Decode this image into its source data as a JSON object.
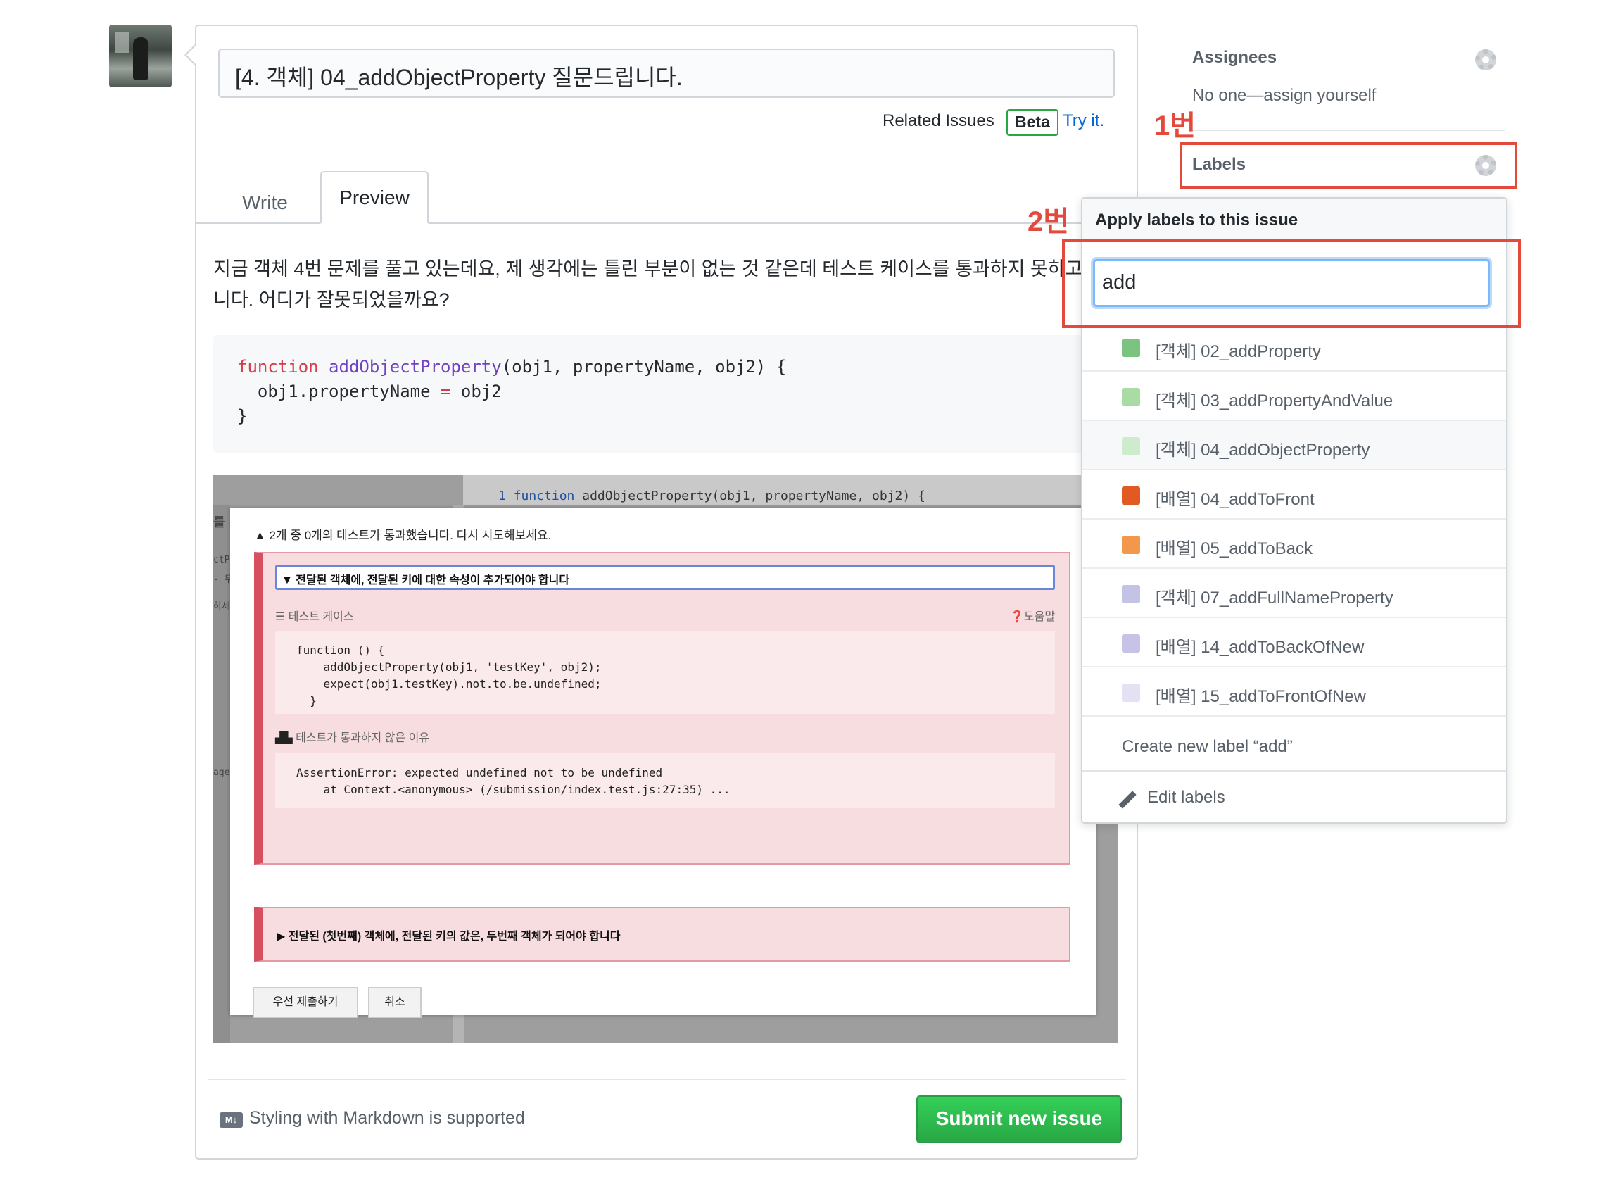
{
  "issue": {
    "title_value": "[4. 객체] 04_addObjectProperty 질문드립니다.",
    "related_label": "Related Issues",
    "beta_badge": "Beta",
    "try_link": "Try it."
  },
  "tabs": {
    "write": "Write",
    "preview": "Preview"
  },
  "preview": {
    "text_line1": "지금 객체 4번 문제를 풀고 있는데요, 제 생각에는 틀린 부분이 없는 것 같은데 테스트 케이스를 통과하지 못하고",
    "text_line2": "니다. 어디가 잘못되었을까요?",
    "code": {
      "kw": "function",
      "fn": "addObjectProperty",
      "sig_rest": "(obj1, propertyName, obj2) {",
      "line2_a": "  obj1.propertyName ",
      "line2_op": "=",
      "line2_b": " obj2",
      "line3": "}"
    }
  },
  "screenshot": {
    "code_line_num": "1",
    "code_line_kw": "function",
    "code_line_rest": " addObjectProperty(obj1, propertyName, obj2) {",
    "side_texts": [
      "를 객",
      "ctPr",
      "- 두",
      "하세",
      "age:"
    ],
    "warning": "▲ 2개 중 0개의 테스트가 통과했습니다. 다시 시도해보세요.",
    "test1_title": "▼ 전달된 객체에, 전달된 키에 대한 속성이 추가되어야 합니다",
    "test_case_label": "☰ 테스트 케이스",
    "help_label": "❓도움말",
    "test_code": "function () {\n    addObjectProperty(obj1, 'testKey', obj2);\n    expect(obj1.testKey).not.to.be.undefined;\n  }",
    "reason_label": "테스트가 통과하지 않은 이유",
    "reason_code": "AssertionError: expected undefined not to be undefined\n    at Context.<anonymous> (/submission/index.test.js:27:35) ...",
    "test2_title": "▶ 전달된 (첫번째) 객체에, 전달된 키의 값은, 두번째 객체가 되어야 합니다",
    "btn_submit_first": "우선 제출하기",
    "btn_cancel": "취소"
  },
  "footer": {
    "md_icon": "M↓",
    "md_text": "Styling with Markdown is supported",
    "submit_label": "Submit new issue"
  },
  "sidebar": {
    "assignees_heading": "Assignees",
    "assignees_value": "No one—assign yourself",
    "labels_heading": "Labels",
    "annotation_1": "1번",
    "annotation_2": "2번"
  },
  "label_dropdown": {
    "header": "Apply labels to this issue",
    "filter_value": "add",
    "items": [
      {
        "name": "[객체] 02_addProperty",
        "color": "#7bc47f"
      },
      {
        "name": "[객체] 03_addPropertyAndValue",
        "color": "#a9dba5"
      },
      {
        "name": "[객체] 04_addObjectProperty",
        "color": "#cdeccb"
      },
      {
        "name": "[배열] 04_addToFront",
        "color": "#e15a24"
      },
      {
        "name": "[배열] 05_addToBack",
        "color": "#f3974a"
      },
      {
        "name": "[객체] 07_addFullNameProperty",
        "color": "#c3c3e6"
      },
      {
        "name": "[배열] 14_addToBackOfNew",
        "color": "#c6c3e6"
      },
      {
        "name": "[배열] 15_addToFrontOfNew",
        "color": "#e3e1f3"
      }
    ],
    "create_label": "Create new label “add”",
    "edit_label": "Edit labels"
  }
}
